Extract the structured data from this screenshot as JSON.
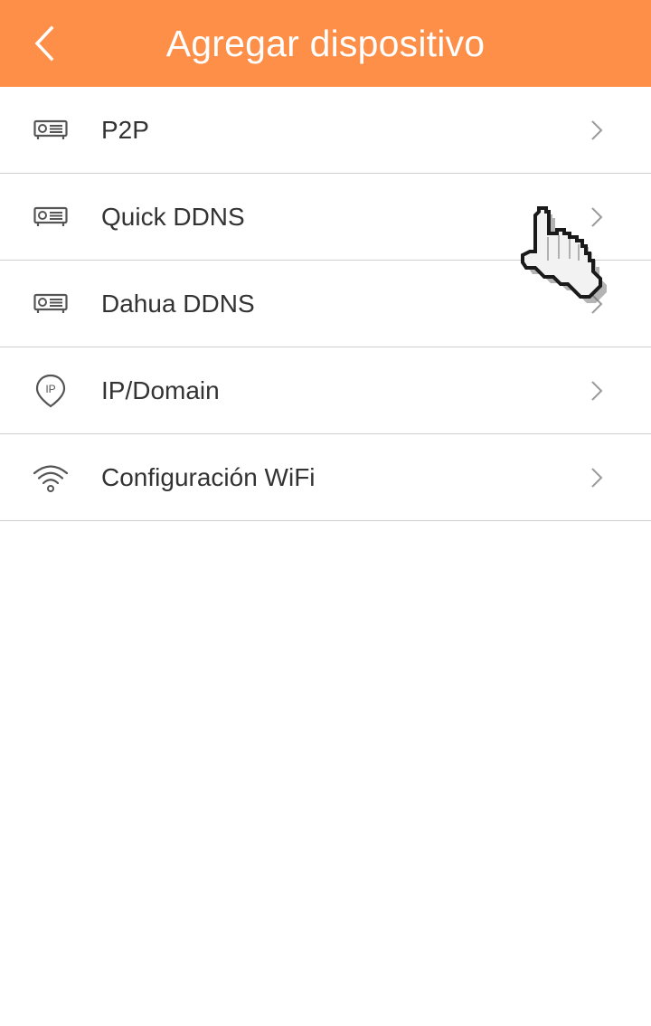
{
  "app_bar": {
    "title": "Agregar dispositivo",
    "back_icon": "chevron-left-icon",
    "color": "#fe8f48"
  },
  "menu": {
    "items": [
      {
        "label": "P2P",
        "icon": "device-recorder-icon"
      },
      {
        "label": "Quick DDNS",
        "icon": "device-recorder-icon"
      },
      {
        "label": "Dahua DDNS",
        "icon": "device-recorder-icon"
      },
      {
        "label": "IP/Domain",
        "icon": "ip-location-pin-icon"
      },
      {
        "label": "Configuración WiFi",
        "icon": "wifi-icon"
      }
    ],
    "chevron_icon": "chevron-right-icon"
  },
  "overlay": {
    "cursor_icon": "hand-pointer-cursor-icon"
  }
}
